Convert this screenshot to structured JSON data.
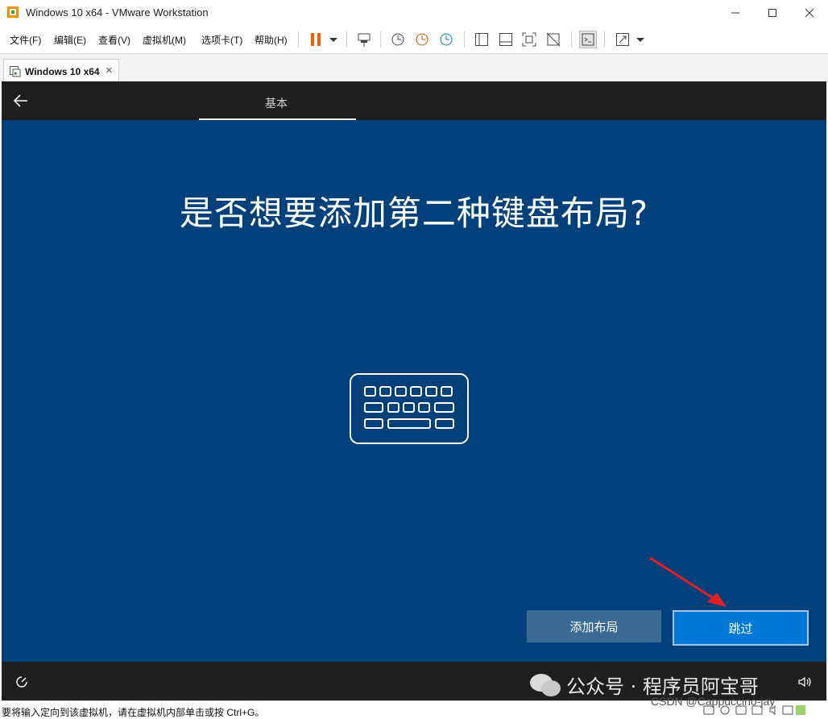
{
  "window": {
    "title": "Windows 10 x64 - VMware Workstation"
  },
  "menu": {
    "items": [
      "文件(F)",
      "编辑(E)",
      "查看(V)",
      "虚拟机(M)",
      "选项卡(T)",
      "帮助(H)"
    ]
  },
  "tab": {
    "label": "Windows 10 x64",
    "close": "×"
  },
  "oobe": {
    "nav_label": "基本",
    "heading": "是否想要添加第二种键盘布局?",
    "add_button": "添加布局",
    "skip_button": "跳过"
  },
  "status": {
    "text": "要将输入定向到该虚拟机，请在虚拟机内部单击或按 Ctrl+G。"
  },
  "watermark": {
    "text": "公众号 · 程序员阿宝哥",
    "csdn": "CSDN @Cappuccino-jay"
  },
  "colors": {
    "oobe_bg": "#00407b",
    "skip": "#0078d7",
    "add": "#3a6a96",
    "pause": "#f06000"
  }
}
